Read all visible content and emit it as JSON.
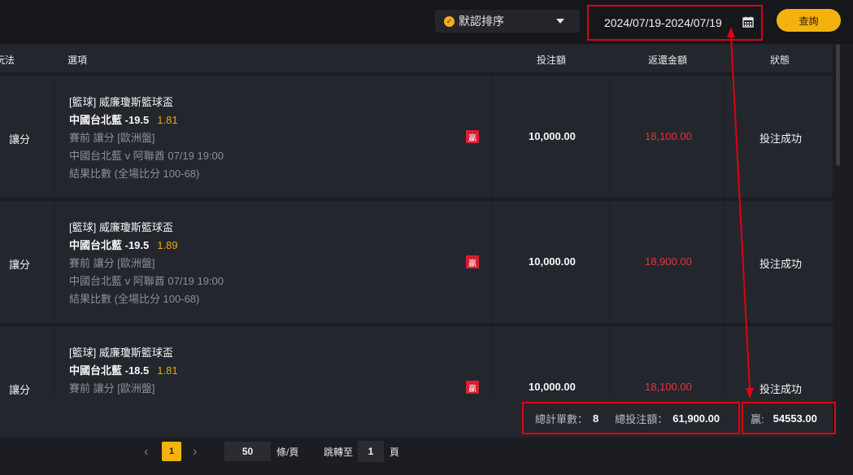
{
  "header": {
    "sort_label": "默認排序",
    "date_range": "2024/07/19-2024/07/19",
    "query_label": "查詢"
  },
  "columns": {
    "play_type": "玩法",
    "option": "選項",
    "stake": "投注額",
    "payout": "返還金額",
    "status": "狀態"
  },
  "rows": [
    {
      "play_type": "讓分",
      "league": "[籃球] 威廉瓊斯籃球盃",
      "selection": "中國台北藍 -19.5",
      "odds": "1.81",
      "market": "賽前 讓分 [歐洲盤]",
      "match": "中國台北藍 v 阿聯酋    07/19 19:00",
      "result": "結果比數 (全場比分 100-68)",
      "badge": "贏",
      "stake": "10,000.00",
      "payout": "18,100.00",
      "status": "投注成功"
    },
    {
      "play_type": "讓分",
      "league": "[籃球] 威廉瓊斯籃球盃",
      "selection": "中國台北藍 -19.5",
      "odds": "1.89",
      "market": "賽前 讓分 [歐洲盤]",
      "match": "中國台北藍 v 阿聯酋    07/19 19:00",
      "result": "結果比數 (全場比分 100-68)",
      "badge": "贏",
      "stake": "10,000.00",
      "payout": "18,900.00",
      "status": "投注成功"
    },
    {
      "play_type": "讓分",
      "league": "[籃球] 威廉瓊斯籃球盃",
      "selection": "中國台北藍 -18.5",
      "odds": "1.81",
      "market": "賽前 讓分 [歐洲盤]",
      "match": "",
      "result": "",
      "badge": "贏",
      "stake": "10,000.00",
      "payout": "18,100.00",
      "status": "投注成功"
    }
  ],
  "summary": {
    "count_label": "總計單數：",
    "count_value": "8",
    "total_label": "總投注額：",
    "total_value": "61,900.00",
    "win_label": "贏:",
    "win_value": "54553.00"
  },
  "pagination": {
    "current_page": "1",
    "page_size": "50",
    "page_size_unit": "條/頁",
    "jump_label": "跳轉至",
    "jump_value": "1",
    "page_unit": "頁"
  },
  "colors": {
    "accent": "#f5b20e",
    "annotation": "#e00012",
    "payout": "#e8333c",
    "odds": "#f4a51a"
  }
}
